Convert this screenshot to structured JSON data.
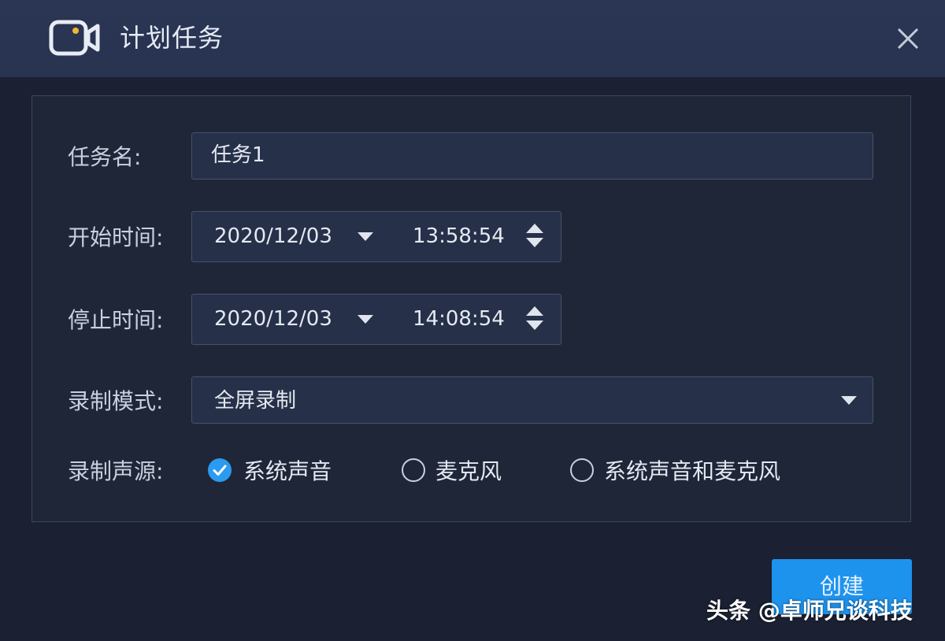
{
  "window": {
    "title": "计划任务",
    "icons": {
      "app": "video-camera-icon",
      "close": "close-icon"
    }
  },
  "form": {
    "task_name": {
      "label": "任务名:",
      "value": "任务1"
    },
    "start_time": {
      "label": "开始时间:",
      "date": "2020/12/03",
      "time": "13:58:54"
    },
    "stop_time": {
      "label": "停止时间:",
      "date": "2020/12/03",
      "time": "14:08:54"
    },
    "record_mode": {
      "label": "录制模式:",
      "selected": "全屏录制"
    },
    "audio_source": {
      "label": "录制声源:",
      "options": [
        {
          "label": "系统声音",
          "selected": true
        },
        {
          "label": "麦克风",
          "selected": false
        },
        {
          "label": "系统声音和麦克风",
          "selected": false
        }
      ]
    }
  },
  "actions": {
    "create_label": "创建"
  },
  "watermark": "头条 @卓师兄谈科技",
  "colors": {
    "titlebar": "#273350",
    "background": "#1b2132",
    "accent": "#1e93ee",
    "field_bg": "#263048"
  }
}
